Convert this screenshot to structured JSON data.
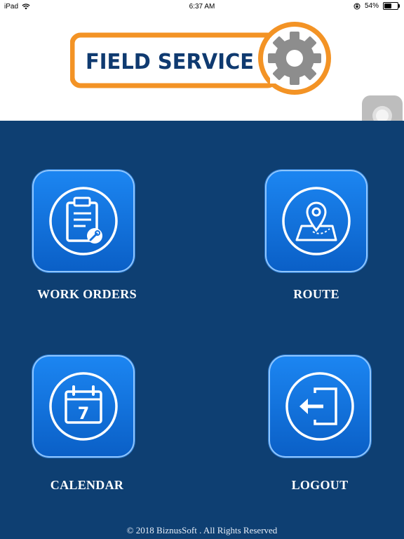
{
  "status_bar": {
    "device": "iPad",
    "time": "6:37 AM",
    "battery_percent": "54%",
    "battery_level": 0.54,
    "icons": [
      "wifi-icon",
      "orientation-lock-icon",
      "battery-icon"
    ]
  },
  "header": {
    "logo_text": "FIELD SERVICE",
    "logo_colors": {
      "frame": "#f39325",
      "text": "#0f3a70",
      "gear": "#8d8d8d"
    }
  },
  "menu": {
    "work_orders": {
      "label": "WORK ORDERS",
      "icon": "clipboard-icon"
    },
    "route": {
      "label": "ROUTE",
      "icon": "map-pin-icon"
    },
    "calendar": {
      "label": "CALENDAR",
      "icon": "calendar-icon",
      "day": "7"
    },
    "logout": {
      "label": "LOGOUT",
      "icon": "logout-icon"
    }
  },
  "footer": {
    "copyright": "© 2018 BiznusSoft . All Rights Reserved"
  },
  "colors": {
    "background": "#0e3f72",
    "tile_top": "#1c86f2",
    "tile_bottom": "#0a5fc6"
  }
}
